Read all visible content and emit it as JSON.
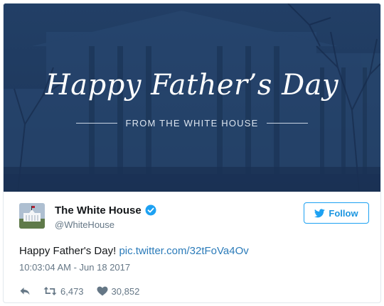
{
  "hero": {
    "title": "Happy Father’s Day",
    "subtitle": "FROM THE WHITE HOUSE"
  },
  "account": {
    "display_name": "The White House",
    "handle": "@WhiteHouse",
    "verified": true
  },
  "follow_button": {
    "label": "Follow"
  },
  "tweet": {
    "text": "Happy Father's Day!",
    "link": "pic.twitter.com/32tFoVa4Ov",
    "timestamp": "10:03:04 AM - Jun 18 2017"
  },
  "actions": {
    "retweet_count": "6,473",
    "like_count": "30,852"
  },
  "icons": {
    "reply": "reply-icon",
    "retweet": "retweet-icon",
    "like": "heart-icon",
    "verified": "verified-badge-icon",
    "follow": "twitter-bird-icon"
  },
  "colors": {
    "hero_background": "#1f3a5e",
    "link": "#2b7bb9",
    "follow_accent": "#1da1f2",
    "muted_text": "#657786"
  }
}
